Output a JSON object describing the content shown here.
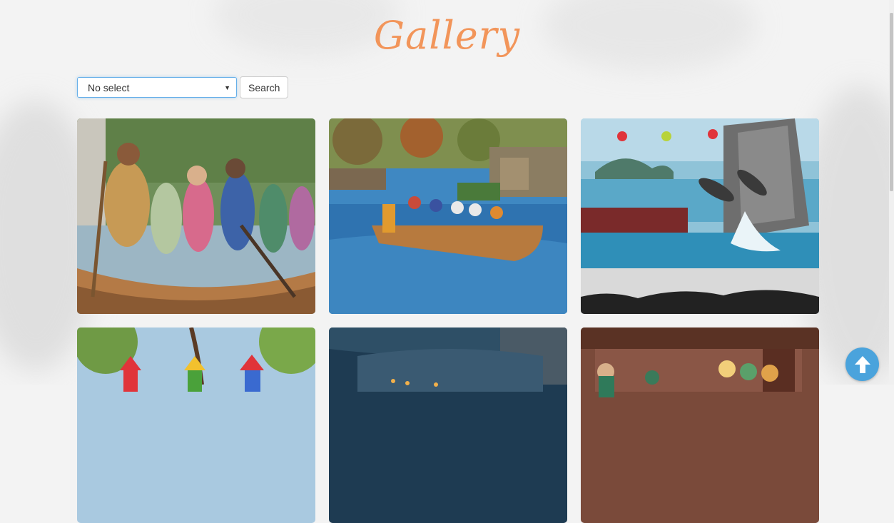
{
  "page": {
    "title": "Gallery"
  },
  "search": {
    "select_value": "No select",
    "button_label": "Search"
  },
  "gallery": {
    "images": [
      {
        "name": "Canoe riders paddling"
      },
      {
        "name": "Canoe on river"
      },
      {
        "name": "Safari World dolphin show"
      },
      {
        "name": "Playground"
      },
      {
        "name": "Boat ride tunnel"
      },
      {
        "name": "Castle stage show"
      }
    ]
  },
  "colors": {
    "title": "#f2955a",
    "accent": "#4aa3dc",
    "select_border": "#66afe9"
  },
  "icons": {
    "scroll_top": "arrow-up-icon",
    "dropdown": "caret-down-icon"
  }
}
